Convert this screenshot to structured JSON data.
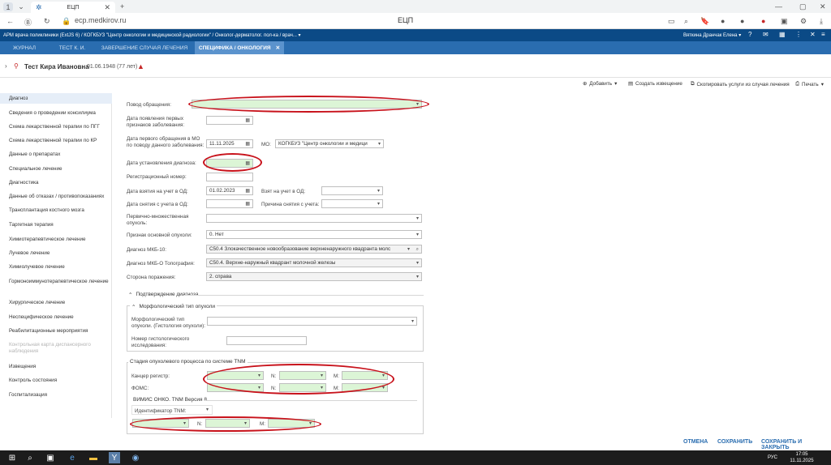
{
  "browser": {
    "tab_count": "1",
    "tab_title": "ЕЦП",
    "url": "ecp.medkirov.ru",
    "page_title": "ЕЦП"
  },
  "app": {
    "header": "АРМ врача поликлиники (ExtJS 6) / КОГКБУЗ \"Центр онкологии и медицинской радиологии\" / Онколог-дерматолог. пол-ка / врач... ▾",
    "user": "Вяткина Дранчак Елена ▾",
    "tabs": [
      "ЖУРНАЛ",
      "ТЕСТ К. И.",
      "ЗАВЕРШЕНИЕ СЛУЧАЯ ЛЕЧЕНИЯ",
      "СПЕЦИФИКА / ОНКОЛОГИЯ"
    ]
  },
  "patient": {
    "name": "Тест Кира Ивановна",
    "birth": "01.06.1948 (77 лет)"
  },
  "toolbar": {
    "add": "Добавить",
    "create_notice": "Создать извещение",
    "copy_services": "Скопировать услуги из случая лечения",
    "print": "Печать"
  },
  "sidebar": [
    {
      "label": "Диагноз",
      "state": "active"
    },
    {
      "label": "Сведения о проведении консилиума",
      "state": "normal"
    },
    {
      "label": "Схема лекарственной терапии по ПГГ",
      "state": "normal"
    },
    {
      "label": "Схема лекарственной терапии по КР",
      "state": "normal"
    },
    {
      "label": "Данные о препаратах",
      "state": "normal"
    },
    {
      "label": "Специальное лечение",
      "state": "normal"
    },
    {
      "label": "Диагностика",
      "state": "normal"
    },
    {
      "label": "Данные об отказах / противопоказаниях",
      "state": "normal"
    },
    {
      "label": "Трансплантация костного мозга",
      "state": "normal"
    },
    {
      "label": "Таргетная терапия",
      "state": "normal"
    },
    {
      "label": "Химиотерапевтическое лечение",
      "state": "normal"
    },
    {
      "label": "Лучевое лечение",
      "state": "normal"
    },
    {
      "label": "Химиолучевое лечение",
      "state": "normal"
    },
    {
      "label": "Гормоноиммунотерапевтическое лечение",
      "state": "normal"
    },
    {
      "label": "Хирургическое лечение",
      "state": "normal"
    },
    {
      "label": "Неспецифическое лечение",
      "state": "normal"
    },
    {
      "label": "Реабилитационные мероприятия",
      "state": "normal"
    },
    {
      "label": "Контрольная карта диспансерного наблюдения",
      "state": "disabled"
    },
    {
      "label": "Извещения",
      "state": "normal"
    },
    {
      "label": "Контроль состояния",
      "state": "normal"
    },
    {
      "label": "Госпитализация",
      "state": "normal"
    }
  ],
  "form": {
    "povod_label": "Повод обращения:",
    "date_first_symptoms_label": "Дата появления первых признаков заболевания:",
    "date_first_visit_label": "Дата первого обращения в МО по поводу данного заболевания:",
    "date_first_visit_value": "11.11.2025",
    "mo_label": "МО:",
    "mo_value": "КОГКБУЗ \"Центр онкологии и медици",
    "date_diag_label": "Дата установления диагноза:",
    "reg_number_label": "Регистрационный номер:",
    "date_taken_label": "Дата взятия на учет в ОД:",
    "date_taken_value": "01.02.2023",
    "taken_in_od_label": "Взят на учет в ОД:",
    "date_removed_label": "Дата снятия с учета в ОД:",
    "removal_reason_label": "Причина снятия с учета:",
    "primary_multiple_label": "Первично-множественная опухоль:",
    "main_tumor_sign_label": "Признак основной опухоли:",
    "main_tumor_sign_value": "0. Нет",
    "mkb10_label": "Диагноз МКБ-10:",
    "mkb10_value": "C50.4 Злокачественное новообразование верхненаружного квадранта молс",
    "mkbo_label": "Диагноз МКБ-О Топография:",
    "mkbo_value": "C50.4. Верхне-наружный квадрант молочной железы",
    "side_label": "Сторона поражения:",
    "side_value": "2. справа",
    "confirm_section": "Подтверждение диагноза",
    "morph_section": "Морфологический тип опухоли",
    "morph_type_label": "Морфологический тип опухоли. (Гистология опухоли):",
    "histo_number_label": "Номер гистологического исследования:",
    "tnm_section": "Стадия опухолевого процесса по системе TNM",
    "cancer_register_label": "Канцер регистр:",
    "foms_label": "ФОМС:",
    "n_label": "N:",
    "m_label": "M:",
    "vimis_section": "ВИМИС ОНКО. TNM Версия 8",
    "tnm_id_label": "Идентификатор TNM:"
  },
  "footer": {
    "cancel": "ОТМЕНА",
    "save": "СОХРАНИТЬ",
    "save_close": "СОХРАНИТЬ И ЗАКРЫТЬ"
  },
  "taskbar": {
    "lang": "РУС",
    "time": "17:05",
    "date": "11.11.2025"
  },
  "colors": {
    "app_header": "#0b4a86",
    "nav": "#2a6db0",
    "active_tab": "#5b93cd",
    "highlight_ring": "#c8121b",
    "green_field": "#dcf5d6"
  }
}
